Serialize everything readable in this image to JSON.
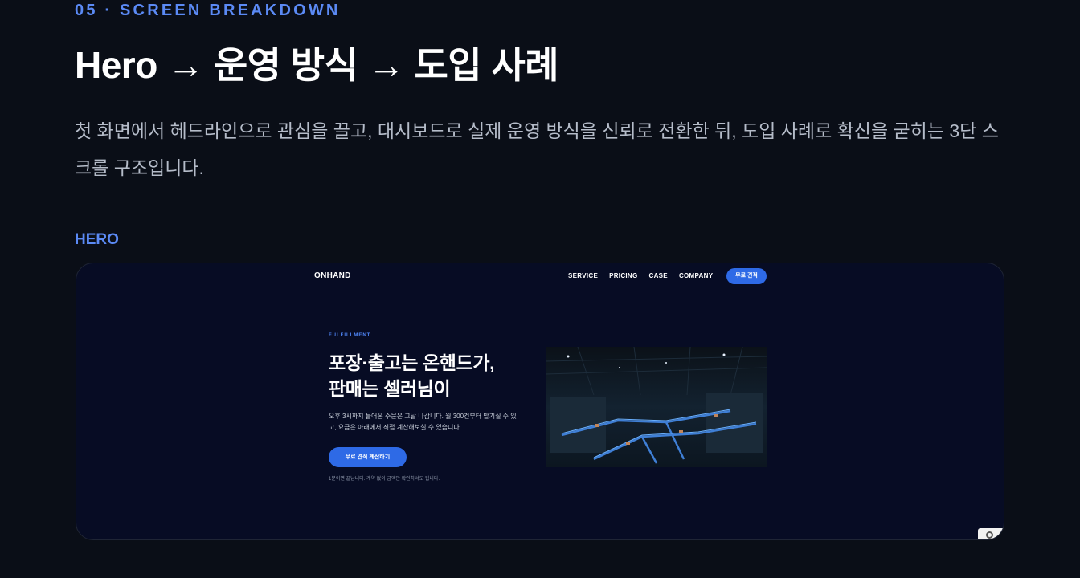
{
  "section": {
    "eyebrow": "05 · SCREEN BREAKDOWN",
    "title": "Hero → 운영 방식 → 도입 사례",
    "description": "첫 화면에서 헤드라인으로 관심을 끌고, 대시보드로 실제 운영 방식을 신뢰로 전환한 뒤, 도입 사례로 확신을 굳히는 3단 스크롤 구조입니다.",
    "sub_label": "HERO"
  },
  "preview": {
    "brand": "ONHAND",
    "nav": [
      "SERVICE",
      "PRICING",
      "CASE",
      "COMPANY"
    ],
    "nav_cta": "무료 견적",
    "hero": {
      "eyebrow": "FULFILLMENT",
      "title_line1": "포장·출고는 온핸드가,",
      "title_line2": "판매는 셀러님이",
      "description": "오후 3시까지 들어온 주문은 그날 나갑니다. 월 300건부터 맡기실 수 있고, 요금은 아래에서 직접 계산해보실 수 있습니다.",
      "cta": "무료 견적 계산하기",
      "note": "1분이면 끝납니다. 계약 없이 금액만 확인하셔도 됩니다."
    },
    "image_icon": "warehouse-photo",
    "widget_icon": "search-icon"
  },
  "colors": {
    "background": "#0a0e17",
    "accent": "#5b8af5",
    "preview_background": "#070c24",
    "button": "#2e6ae6"
  }
}
